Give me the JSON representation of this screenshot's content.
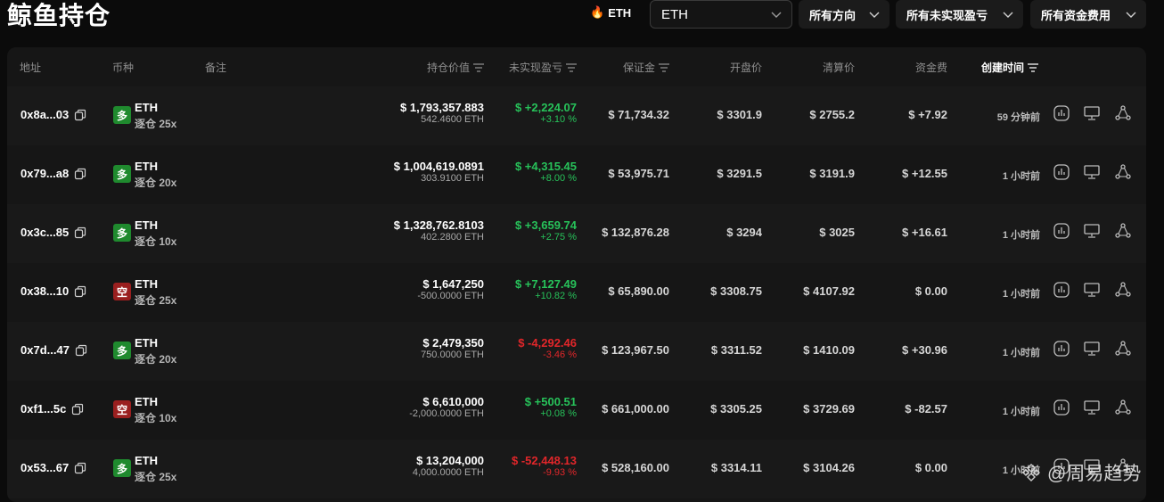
{
  "page": {
    "title": "鲸鱼持仓"
  },
  "token_tag": {
    "icon": "fire-icon",
    "label": "ETH"
  },
  "filters": {
    "coin_select": "ETH",
    "direction": "所有方向",
    "pnl": "所有未实现盈亏",
    "funding": "所有资金费用"
  },
  "columns": {
    "address": "地址",
    "coin": "币种",
    "note": "备注",
    "value": "持仓价值",
    "pnl": "未实现盈亏",
    "margin": "保证金",
    "open": "开盘价",
    "liq": "清算价",
    "funding": "资金费",
    "time": "创建时间"
  },
  "rows": [
    {
      "address": "0x8a...03",
      "side": "多",
      "side_type": "long",
      "coin": "ETH",
      "leverage": "逐仓 25x",
      "value": "$ 1,793,357.883",
      "size": "542.4600 ETH",
      "pnl": "$ +2,224.07",
      "pnl_pct": "+3.10 %",
      "pnl_sign": "pos",
      "margin": "$ 71,734.32",
      "open": "$ 3301.9",
      "liq": "$ 2755.2",
      "funding": "$ +7.92",
      "funding_sign": "pos",
      "time": "59 分钟前"
    },
    {
      "address": "0x79...a8",
      "side": "多",
      "side_type": "long",
      "coin": "ETH",
      "leverage": "逐仓 20x",
      "value": "$ 1,004,619.0891",
      "size": "303.9100 ETH",
      "pnl": "$ +4,315.45",
      "pnl_pct": "+8.00 %",
      "pnl_sign": "pos",
      "margin": "$ 53,975.71",
      "open": "$ 3291.5",
      "liq": "$ 3191.9",
      "funding": "$ +12.55",
      "funding_sign": "pos",
      "time": "1 小时前"
    },
    {
      "address": "0x3c...85",
      "side": "多",
      "side_type": "long",
      "coin": "ETH",
      "leverage": "逐仓 10x",
      "value": "$ 1,328,762.8103",
      "size": "402.2800 ETH",
      "pnl": "$ +3,659.74",
      "pnl_pct": "+2.75 %",
      "pnl_sign": "pos",
      "margin": "$ 132,876.28",
      "open": "$ 3294",
      "liq": "$ 3025",
      "funding": "$ +16.61",
      "funding_sign": "pos",
      "time": "1 小时前"
    },
    {
      "address": "0x38...10",
      "side": "空",
      "side_type": "short",
      "coin": "ETH",
      "leverage": "逐仓 25x",
      "value": "$ 1,647,250",
      "size": "-500.0000 ETH",
      "pnl": "$ +7,127.49",
      "pnl_pct": "+10.82 %",
      "pnl_sign": "pos",
      "margin": "$ 65,890.00",
      "open": "$ 3308.75",
      "liq": "$ 4107.92",
      "funding": "$ 0.00",
      "funding_sign": "zero",
      "time": "1 小时前"
    },
    {
      "address": "0x7d...47",
      "side": "多",
      "side_type": "long",
      "coin": "ETH",
      "leverage": "逐仓 20x",
      "value": "$ 2,479,350",
      "size": "750.0000 ETH",
      "pnl": "$ -4,292.46",
      "pnl_pct": "-3.46 %",
      "pnl_sign": "neg",
      "margin": "$ 123,967.50",
      "open": "$ 3311.52",
      "liq": "$ 1410.09",
      "funding": "$ +30.96",
      "funding_sign": "pos",
      "time": "1 小时前"
    },
    {
      "address": "0xf1...5c",
      "side": "空",
      "side_type": "short",
      "coin": "ETH",
      "leverage": "逐仓 10x",
      "value": "$ 6,610,000",
      "size": "-2,000.0000 ETH",
      "pnl": "$ +500.51",
      "pnl_pct": "+0.08 %",
      "pnl_sign": "pos",
      "margin": "$ 661,000.00",
      "open": "$ 3305.25",
      "liq": "$ 3729.69",
      "funding": "$ -82.57",
      "funding_sign": "neg",
      "time": "1 小时前"
    },
    {
      "address": "0x53...67",
      "side": "多",
      "side_type": "long",
      "coin": "ETH",
      "leverage": "逐仓 25x",
      "value": "$ 13,204,000",
      "size": "4,000.0000 ETH",
      "pnl": "$ -52,448.13",
      "pnl_pct": "-9.93 %",
      "pnl_sign": "neg",
      "margin": "$ 528,160.00",
      "open": "$ 3314.11",
      "liq": "$ 3104.26",
      "funding": "$ 0.00",
      "funding_sign": "zero",
      "time": "1 小时前"
    }
  ],
  "row_actions": [
    "chart-icon",
    "monitor-icon",
    "share-icon"
  ],
  "watermark": {
    "icon": "binance-logo-icon",
    "text": "@周易趋势"
  },
  "colors": {
    "positive": "#27c25a",
    "negative": "#e2262a",
    "long": "#1f8a2e",
    "short": "#9a1f1f"
  }
}
